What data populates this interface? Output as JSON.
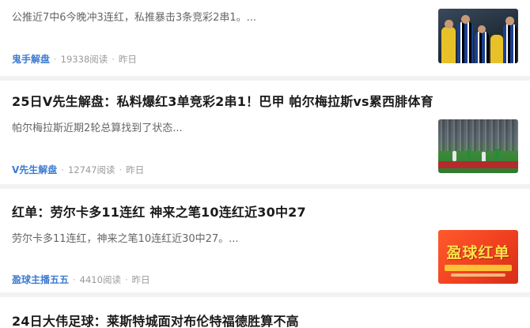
{
  "articles": [
    {
      "title": "",
      "summary": "公推近7中6今晚冲3连红，私推暴击3条竞彩2串1。...",
      "author": "鬼手解盘",
      "reads": "19338阅读",
      "time": "昨日",
      "thumbnail": "football-celebration-image"
    },
    {
      "title": "25日V先生解盘：私料爆红3单竞彩2串1！巴甲 帕尔梅拉斯vs累西腓体育",
      "summary": "帕尔梅拉斯近期2轮总算找到了状态...",
      "author": "V先生解盘",
      "reads": "12747阅读",
      "time": "昨日",
      "thumbnail": "stadium-match-image"
    },
    {
      "title": "红单：劳尔卡多11连红 神来之笔10连红近30中27",
      "summary": "劳尔卡多11连红，神来之笔10连红近30中27。...",
      "author": "盈球主播五五",
      "reads": "4410阅读",
      "time": "昨日",
      "thumbnail": "promo-banner-image",
      "thumbnail_text": "盈球红单"
    },
    {
      "title": "24日大伟足球：莱斯特城面对布伦特福德胜算不高"
    }
  ],
  "colors": {
    "author": "#3d7cd1",
    "title": "#1a1a1a",
    "summary": "#666666",
    "meta": "#9a9a9a",
    "divider": "#f2f2f2"
  }
}
